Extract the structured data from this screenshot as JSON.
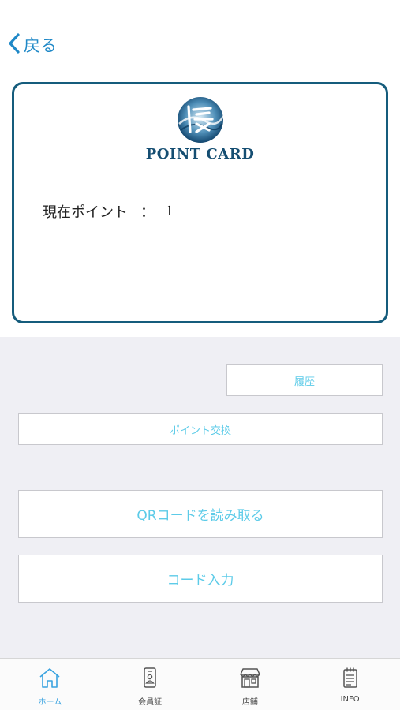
{
  "nav": {
    "back_label": "戻る"
  },
  "card": {
    "logo_text": "POINT CARD",
    "points_label": "現在ポイント",
    "separator": "：",
    "points_value": "1"
  },
  "buttons": {
    "history": "履歴",
    "point_exchange": "ポイント交換",
    "scan_qr": "QRコードを読み取る",
    "code_input": "コード入力"
  },
  "tabs": [
    {
      "label": "ホーム",
      "icon": "home-icon",
      "active": true
    },
    {
      "label": "会員証",
      "icon": "member-card-icon",
      "active": false
    },
    {
      "label": "店舗",
      "icon": "store-icon",
      "active": false
    },
    {
      "label": "INFO",
      "icon": "notepad-icon",
      "active": false
    }
  ],
  "colors": {
    "accent": "#1e88c7",
    "card_border": "#155c7c",
    "button_text": "#5ccbe8",
    "active_tab": "#3aa3e0"
  }
}
